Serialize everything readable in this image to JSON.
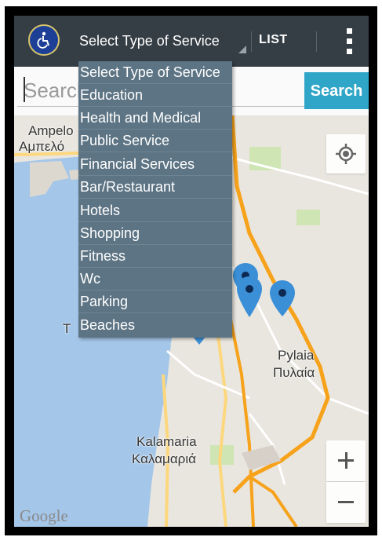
{
  "app": {
    "logo_icon": "wheelchair-icon",
    "service_spinner": {
      "selected": "Select Type of Service"
    },
    "list_button": "LIST",
    "overflow_icon": "more-vert-icon"
  },
  "search": {
    "placeholder": "Search",
    "button_label": "Search"
  },
  "dropdown": {
    "options": [
      "Select Type of Service",
      "Education",
      "Health and Medical",
      "Public Service",
      "Financial Services",
      "Bar/Restaurant",
      "Hotels",
      "Shopping",
      "Fitness",
      "Wc",
      "Parking",
      "Beaches"
    ]
  },
  "map": {
    "labels": {
      "ampelokipoi_latin": "Ampelo",
      "ampelokipoi_greek": "Αμπελό",
      "pylaia_latin": "Pylaia",
      "pylaia_greek": "Πυλαία",
      "kalamaria_latin": "Kalamaria",
      "kalamaria_greek": "Καλαμαριά",
      "fragment_t": "T"
    },
    "attribution": "Google",
    "zoom_in_label": "+",
    "zoom_out_label": "−",
    "locate_icon": "my-location-icon",
    "colors": {
      "water": "#a4c6e9",
      "land": "#e9e6df",
      "highway": "#f7a21b",
      "road": "#fdd77d",
      "marker": "#3b8fd6"
    }
  }
}
